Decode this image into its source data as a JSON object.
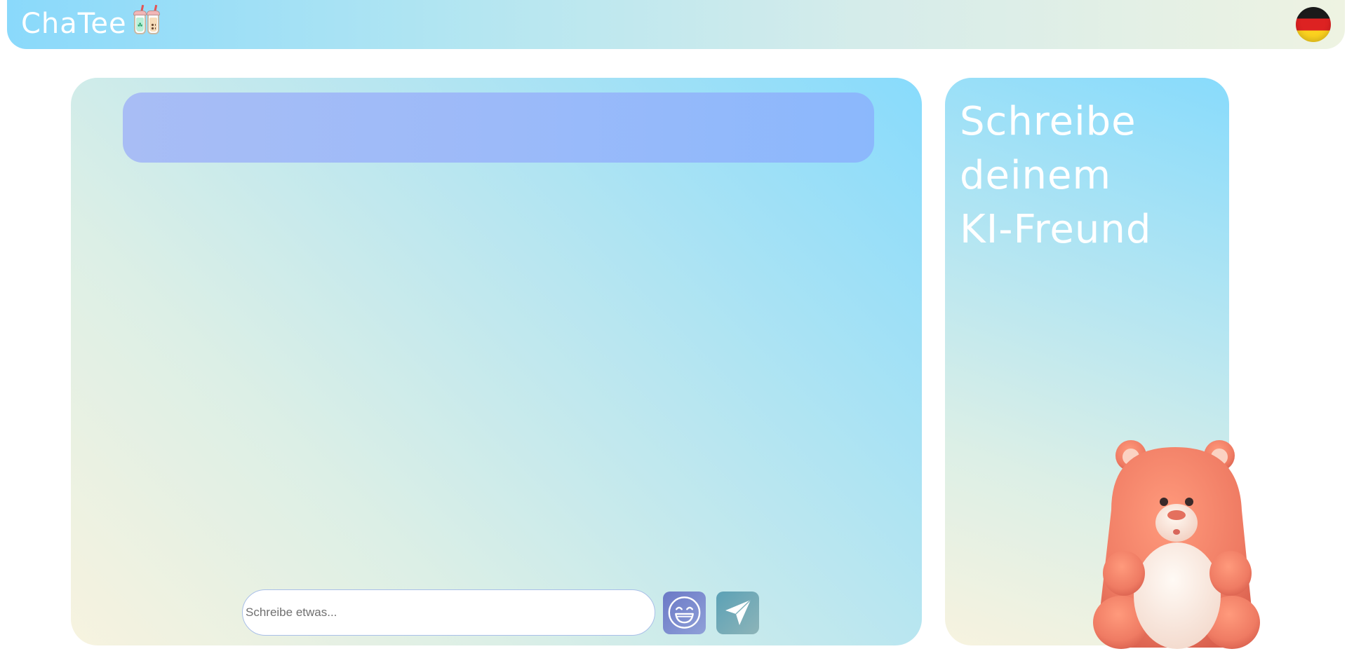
{
  "header": {
    "brand": "ChaTee",
    "brand_icon": "bubble-tea-cups-icon",
    "language_flag": "germany-flag-icon",
    "colors": {
      "gradient_start": "#8ad9fb",
      "gradient_end": "#eef3e2"
    }
  },
  "chat": {
    "banner_text": "",
    "input": {
      "placeholder": "Schreibe etwas...",
      "value": ""
    },
    "emoji_button_icon": "laughing-face-icon",
    "send_button_icon": "paper-plane-icon"
  },
  "side_panel": {
    "title_line1": "Schreibe",
    "title_line2": "deinem",
    "title_line3": "KI-Freund",
    "mascot": "bear-mascot"
  },
  "colors": {
    "panel_blue": "#88dbfc",
    "panel_cream": "#f7f3df",
    "banner": "#9cbaf9",
    "emoji_button": "#6b79c6",
    "send_button": "#5ba1b6",
    "bear": "#f07f68"
  }
}
